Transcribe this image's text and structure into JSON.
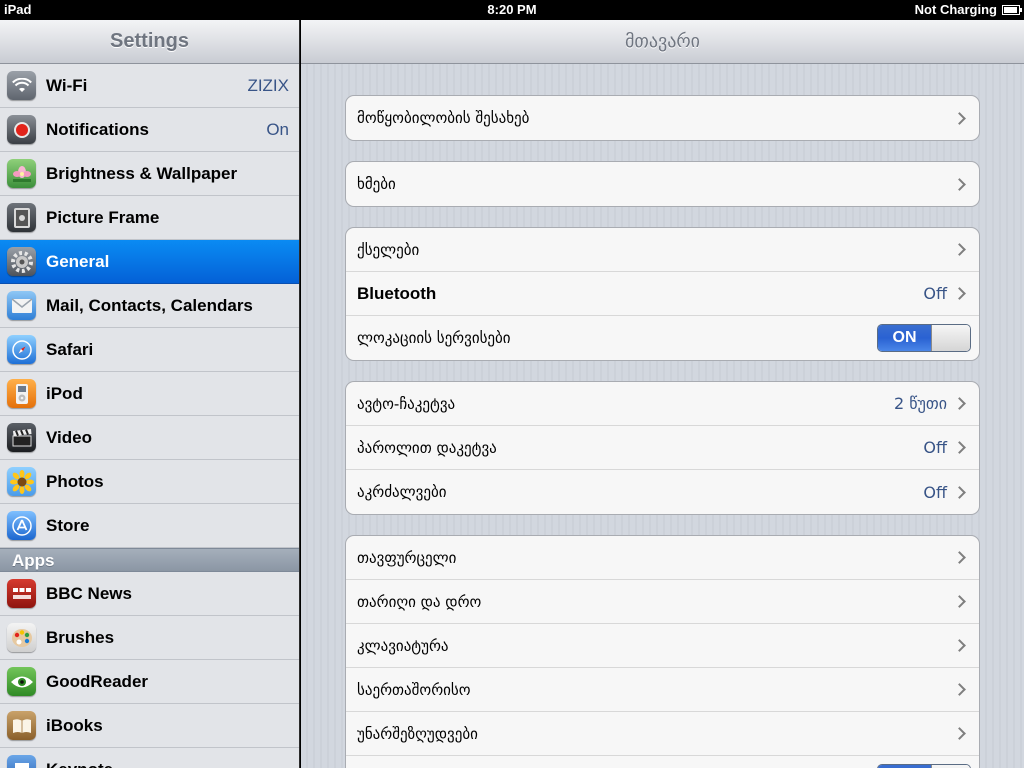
{
  "status_bar": {
    "device": "iPad",
    "time": "8:20 PM",
    "battery_text": "Not Charging"
  },
  "sidebar": {
    "title": "Settings",
    "items": [
      {
        "label": "Wi-Fi",
        "value": "ZIZIX",
        "icon": "wifi-icon"
      },
      {
        "label": "Notifications",
        "value": "On",
        "icon": "notifications-icon"
      },
      {
        "label": "Brightness & Wallpaper",
        "value": "",
        "icon": "brightness-wallpaper-icon"
      },
      {
        "label": "Picture Frame",
        "value": "",
        "icon": "picture-frame-icon"
      },
      {
        "label": "General",
        "value": "",
        "icon": "gear-icon",
        "selected": true
      },
      {
        "label": "Mail, Contacts, Calendars",
        "value": "",
        "icon": "mail-icon"
      },
      {
        "label": "Safari",
        "value": "",
        "icon": "compass-icon"
      },
      {
        "label": "iPod",
        "value": "",
        "icon": "ipod-icon"
      },
      {
        "label": "Video",
        "value": "",
        "icon": "clapper-icon"
      },
      {
        "label": "Photos",
        "value": "",
        "icon": "sunflower-icon"
      },
      {
        "label": "Store",
        "value": "",
        "icon": "app-store-icon"
      }
    ],
    "apps_header": "Apps",
    "apps": [
      {
        "label": "BBC News",
        "icon": "bbc-news-icon"
      },
      {
        "label": "Brushes",
        "icon": "palette-icon"
      },
      {
        "label": "GoodReader",
        "icon": "eye-icon"
      },
      {
        "label": "iBooks",
        "icon": "book-icon"
      },
      {
        "label": "Keynote",
        "icon": "keynote-icon"
      }
    ]
  },
  "main": {
    "title": "მთავარი",
    "groups": [
      [
        {
          "label": "მოწყობილობის შესახებ",
          "value": "",
          "chevron": true
        }
      ],
      [
        {
          "label": "ხმები",
          "value": "",
          "chevron": true
        }
      ],
      [
        {
          "label": "ქსელები",
          "value": "",
          "chevron": true
        },
        {
          "label": "Bluetooth",
          "value": "Off",
          "chevron": true,
          "bold": true
        },
        {
          "label": "ლოკაციის სერვისები",
          "switch": "ON"
        }
      ],
      [
        {
          "label": "ავტო-ჩაკეტვა",
          "value": "2 წუთი",
          "chevron": true
        },
        {
          "label": "პაროლით დაკეტვა",
          "value": "Off",
          "chevron": true
        },
        {
          "label": "აკრძალვები",
          "value": "Off",
          "chevron": true
        }
      ],
      [
        {
          "label": "თავფურცელი",
          "value": "",
          "chevron": true
        },
        {
          "label": "თარიღი და დრო",
          "value": "",
          "chevron": true
        },
        {
          "label": "კლავიატურა",
          "value": "",
          "chevron": true
        },
        {
          "label": "საერთაშორისო",
          "value": "",
          "chevron": true
        },
        {
          "label": "უნარშეზღუდვები",
          "value": "",
          "chevron": true
        },
        {
          "label": "",
          "switch": "ON"
        }
      ]
    ]
  },
  "colors": {
    "selected_blue": "#0461d7",
    "value_blue": "#385487",
    "switch_blue": "#2a62d2"
  }
}
